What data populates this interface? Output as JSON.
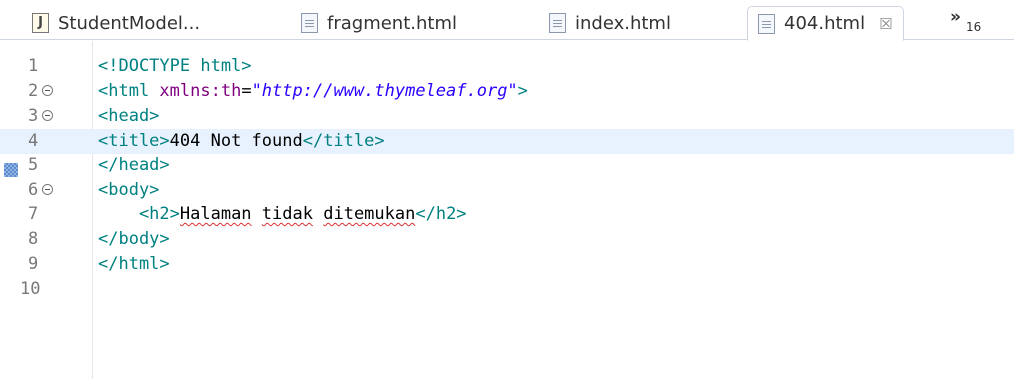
{
  "tabs": [
    {
      "label": "StudentModel...",
      "icon": "java-file-icon",
      "active": false
    },
    {
      "label": "fragment.html",
      "icon": "html-file-icon",
      "active": false
    },
    {
      "label": "index.html",
      "icon": "html-file-icon",
      "active": false
    },
    {
      "label": "404.html",
      "icon": "html-file-icon",
      "active": true,
      "close": "☒"
    }
  ],
  "overflow": {
    "chevron": "»",
    "count": "16"
  },
  "editor": {
    "current_line": 4,
    "lines": [
      {
        "n": "1",
        "t": [
          [
            "tag",
            "<!DOCTYPE html>"
          ]
        ]
      },
      {
        "n": "2",
        "t": [
          [
            "tag",
            "<html "
          ],
          [
            "attr",
            "xmlns:th"
          ],
          [
            "txt",
            "="
          ],
          [
            "val",
            "\"http://www.thymeleaf.org\""
          ],
          [
            "tag",
            ">"
          ]
        ]
      },
      {
        "n": "3",
        "t": [
          [
            "tag",
            "<head>"
          ]
        ]
      },
      {
        "n": "4",
        "t": [
          [
            "tag",
            "<title>"
          ],
          [
            "txt",
            "404 Not found"
          ],
          [
            "tag",
            "</title>"
          ]
        ]
      },
      {
        "n": "5",
        "t": [
          [
            "tag",
            "</head>"
          ]
        ]
      },
      {
        "n": "6",
        "t": [
          [
            "tag",
            "<body>"
          ]
        ]
      },
      {
        "n": "7",
        "t": [
          [
            "tag",
            "    <h2>"
          ],
          [
            "txt",
            "Halaman"
          ],
          [
            "txt",
            " "
          ],
          [
            "txt",
            "tidak"
          ],
          [
            "txt",
            " "
          ],
          [
            "txt",
            "ditemukan"
          ],
          [
            "tag",
            "</h2>"
          ]
        ]
      },
      {
        "n": "8",
        "t": [
          [
            "tag",
            "</body>"
          ]
        ]
      },
      {
        "n": "9",
        "t": [
          [
            "tag",
            "</html>"
          ]
        ]
      },
      {
        "n": "10",
        "t": []
      }
    ]
  },
  "colors": {
    "tag": "#008080",
    "attribute": "#7f007f",
    "string": "#2a00ff",
    "text": "#000000",
    "current_line_highlight": "#e8f2fe"
  }
}
